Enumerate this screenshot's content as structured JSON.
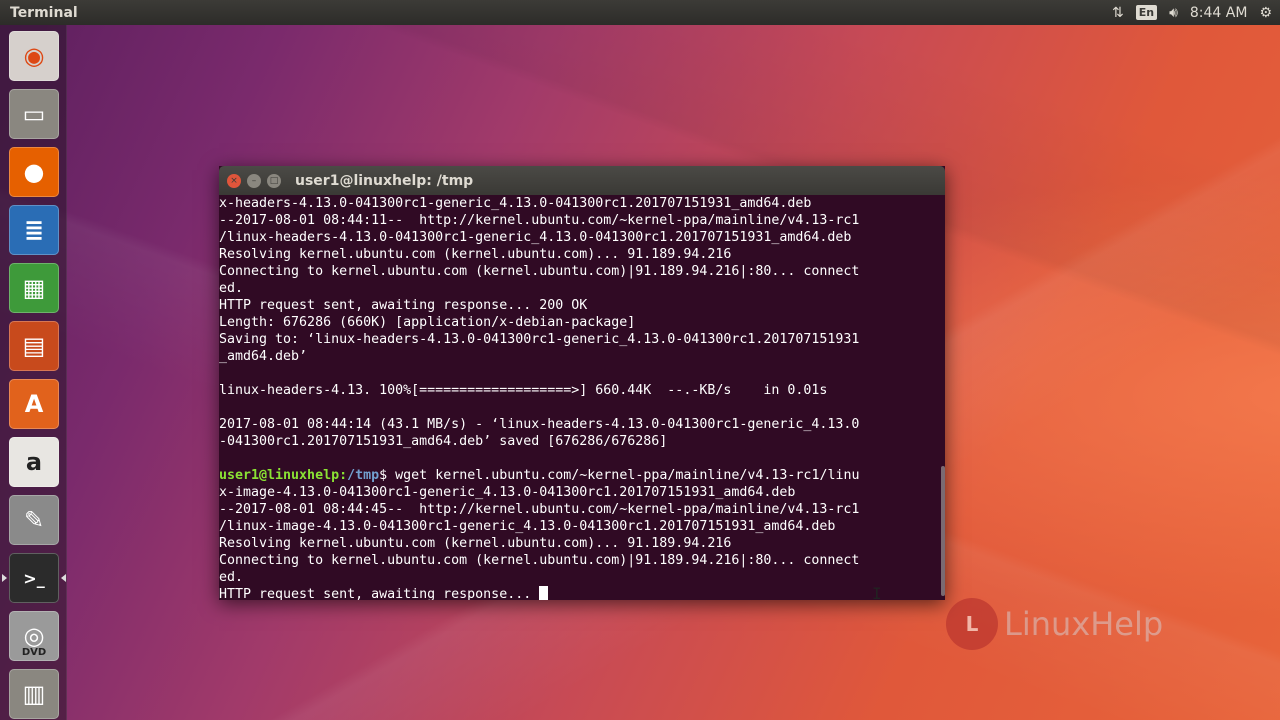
{
  "top_panel": {
    "app_title": "Terminal",
    "network_icon": "network-arrows-icon",
    "keyboard_lang": "En",
    "volume_icon": "speaker-icon",
    "clock": "8:44 AM",
    "settings_icon": "gear-icon"
  },
  "launcher": {
    "items": [
      {
        "name": "ubuntu-dash",
        "icon": "ubuntu-logo-icon",
        "color": "#d6d0cc"
      },
      {
        "name": "files",
        "icon": "file-cabinet-icon",
        "color": "#8a8780"
      },
      {
        "name": "firefox",
        "icon": "firefox-icon",
        "color": "#e66000"
      },
      {
        "name": "writer",
        "icon": "document-icon",
        "color": "#2a6db5"
      },
      {
        "name": "calc",
        "icon": "spreadsheet-icon",
        "color": "#3e9a3a"
      },
      {
        "name": "impress",
        "icon": "presentation-icon",
        "color": "#c84a1c"
      },
      {
        "name": "software-center",
        "icon": "shopping-bag-icon",
        "color": "#e1621c"
      },
      {
        "name": "amazon",
        "icon": "amazon-icon",
        "color": "#e8e6e2"
      },
      {
        "name": "system-settings",
        "icon": "wrench-gear-icon",
        "color": "#8a8a8a"
      },
      {
        "name": "terminal",
        "icon": "terminal-icon",
        "color": "#2b2b2b",
        "active": true
      },
      {
        "name": "dvd",
        "icon": "dvd-icon",
        "color": "#9a9a9a",
        "label": "DVD"
      },
      {
        "name": "trash",
        "icon": "trash-icon",
        "color": "#8a8780"
      }
    ]
  },
  "terminal": {
    "title": "user1@linuxhelp: /tmp",
    "prompt_user": "user1@linuxhelp",
    "prompt_path": "/tmp",
    "lines_before": [
      "x-headers-4.13.0-041300rc1-generic_4.13.0-041300rc1.201707151931_amd64.deb",
      "--2017-08-01 08:44:11--  http://kernel.ubuntu.com/~kernel-ppa/mainline/v4.13-rc1",
      "/linux-headers-4.13.0-041300rc1-generic_4.13.0-041300rc1.201707151931_amd64.deb",
      "Resolving kernel.ubuntu.com (kernel.ubuntu.com)... 91.189.94.216",
      "Connecting to kernel.ubuntu.com (kernel.ubuntu.com)|91.189.94.216|:80... connect",
      "ed.",
      "HTTP request sent, awaiting response... 200 OK",
      "Length: 676286 (660K) [application/x-debian-package]",
      "Saving to: ‘linux-headers-4.13.0-041300rc1-generic_4.13.0-041300rc1.201707151931",
      "_amd64.deb’",
      "",
      "linux-headers-4.13. 100%[===================>] 660.44K  --.-KB/s    in 0.01s",
      "",
      "2017-08-01 08:44:14 (43.1 MB/s) - ‘linux-headers-4.13.0-041300rc1-generic_4.13.0",
      "-041300rc1.201707151931_amd64.deb’ saved [676286/676286]",
      ""
    ],
    "prompt_command": " wget kernel.ubuntu.com/~kernel-ppa/mainline/v4.13-rc1/linu",
    "lines_after": [
      "x-image-4.13.0-041300rc1-generic_4.13.0-041300rc1.201707151931_amd64.deb",
      "--2017-08-01 08:44:45--  http://kernel.ubuntu.com/~kernel-ppa/mainline/v4.13-rc1",
      "/linux-image-4.13.0-041300rc1-generic_4.13.0-041300rc1.201707151931_amd64.deb",
      "Resolving kernel.ubuntu.com (kernel.ubuntu.com)... 91.189.94.216",
      "Connecting to kernel.ubuntu.com (kernel.ubuntu.com)|91.189.94.216|:80... connect",
      "ed."
    ],
    "last_line": "HTTP request sent, awaiting response... "
  },
  "watermark": {
    "text": "LinuxHelp"
  }
}
